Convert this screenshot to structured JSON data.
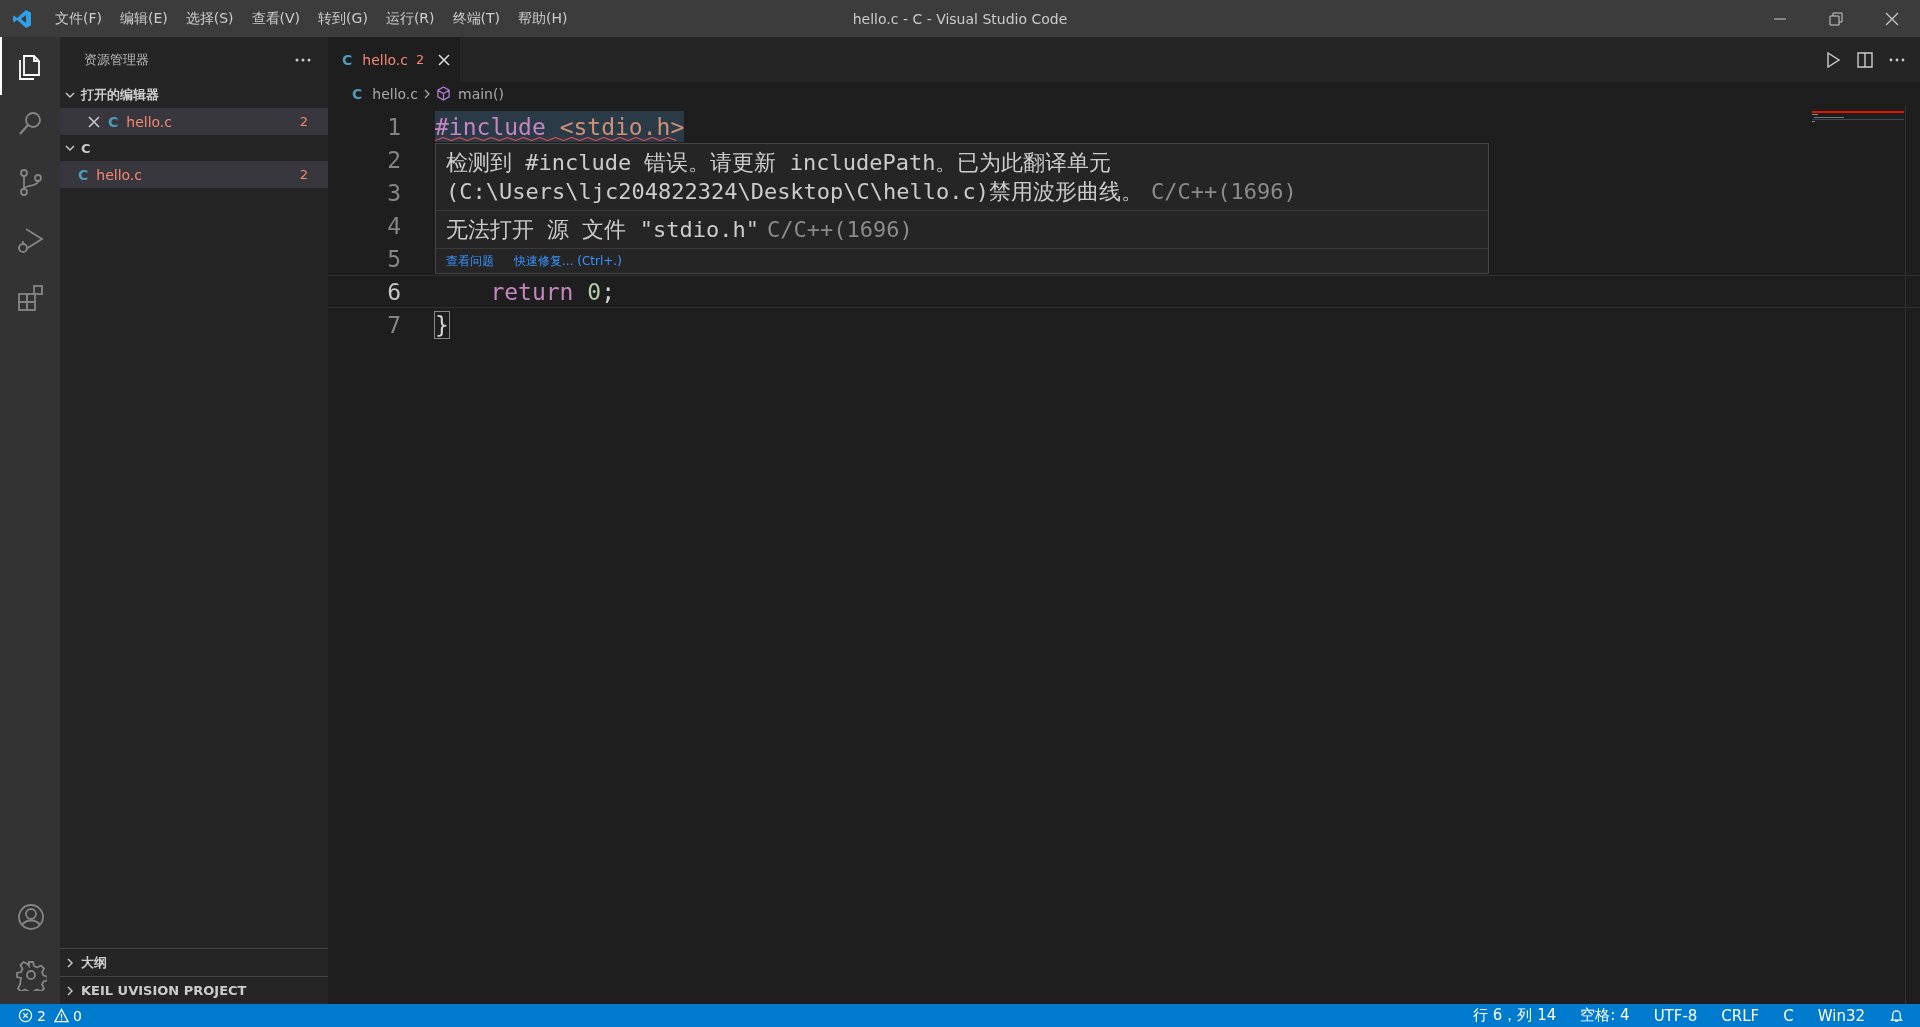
{
  "window": {
    "title": "hello.c - C - Visual Studio Code"
  },
  "menu": [
    "文件(F)",
    "编辑(E)",
    "选择(S)",
    "查看(V)",
    "转到(G)",
    "运行(R)",
    "终端(T)",
    "帮助(H)"
  ],
  "activity_bar": {
    "top": [
      {
        "kind": "explorer",
        "selected": true
      },
      {
        "kind": "search",
        "selected": false
      },
      {
        "kind": "source-control",
        "selected": false
      },
      {
        "kind": "run",
        "selected": false
      },
      {
        "kind": "extensions",
        "selected": false
      }
    ],
    "bottom": [
      {
        "kind": "account",
        "selected": false
      },
      {
        "kind": "settings",
        "selected": false
      }
    ]
  },
  "sidebar": {
    "title": "资源管理器",
    "sections": [
      {
        "title": "打开的编辑器",
        "expanded": true,
        "items": [
          {
            "icon": "C",
            "name": "hello.c",
            "badge": "2",
            "selected": true,
            "closable": true
          }
        ]
      },
      {
        "title": "C",
        "expanded": true,
        "items": [
          {
            "icon": "C",
            "name": "hello.c",
            "badge": "2",
            "selected": true,
            "closable": false
          }
        ]
      }
    ],
    "bottom_sections": [
      {
        "title": "大纲",
        "expanded": false
      },
      {
        "title": "KEIL UVISION PROJECT",
        "expanded": false
      }
    ]
  },
  "tabs": [
    {
      "icon": "C",
      "name": "hello.c",
      "badge": "2",
      "selected": true
    }
  ],
  "breadcrumb": [
    {
      "kind": "file",
      "icon": "C",
      "text": "hello.c"
    },
    {
      "kind": "symbol",
      "text": "main()"
    }
  ],
  "editor": {
    "lines": [
      {
        "number": "1",
        "current": false,
        "error": true,
        "tokens": [
          {
            "kind": "keyword",
            "text": "#include"
          },
          {
            "kind": "string",
            "text": " <stdio.h>"
          }
        ]
      },
      {
        "number": "2",
        "current": false
      },
      {
        "number": "3",
        "current": false
      },
      {
        "number": "4",
        "current": false
      },
      {
        "number": "5",
        "current": false
      },
      {
        "number": "6",
        "current": true,
        "error": false,
        "tokens": [
          {
            "kind": "keyword",
            "text": "    return"
          },
          {
            "kind": "number",
            "text": " 0"
          },
          {
            "kind": "plain",
            "text": ";"
          }
        ]
      },
      {
        "number": "7",
        "current": false,
        "error": false,
        "tokens": [
          {
            "kind": "bracket",
            "text": "}"
          }
        ]
      }
    ],
    "hover": {
      "messages": [
        {
          "text": "检测到 #include 错误。请更新 includePath。已为此翻译单元(C:\\Users\\ljc204822324\\Desktop\\C\\hello.c)禁用波形曲线。",
          "source": "C/C++(1696)"
        },
        {
          "text": "无法打开 源 文件 \"stdio.h\"",
          "source": "C/C++(1696)"
        }
      ],
      "actions": [
        "查看问题",
        "快速修复... (Ctrl+.)"
      ]
    }
  },
  "status_bar": {
    "left": [
      {
        "kind": "errors",
        "text": "2"
      },
      {
        "kind": "warnings",
        "text": "0"
      }
    ],
    "right": [
      {
        "kind": "text",
        "text": "行 6，列 14"
      },
      {
        "kind": "text",
        "text": "空格: 4"
      },
      {
        "kind": "text",
        "text": "UTF-8"
      },
      {
        "kind": "text",
        "text": "CRLF"
      },
      {
        "kind": "text",
        "text": "C"
      },
      {
        "kind": "text",
        "text": "Win32"
      },
      {
        "kind": "bell"
      }
    ]
  }
}
